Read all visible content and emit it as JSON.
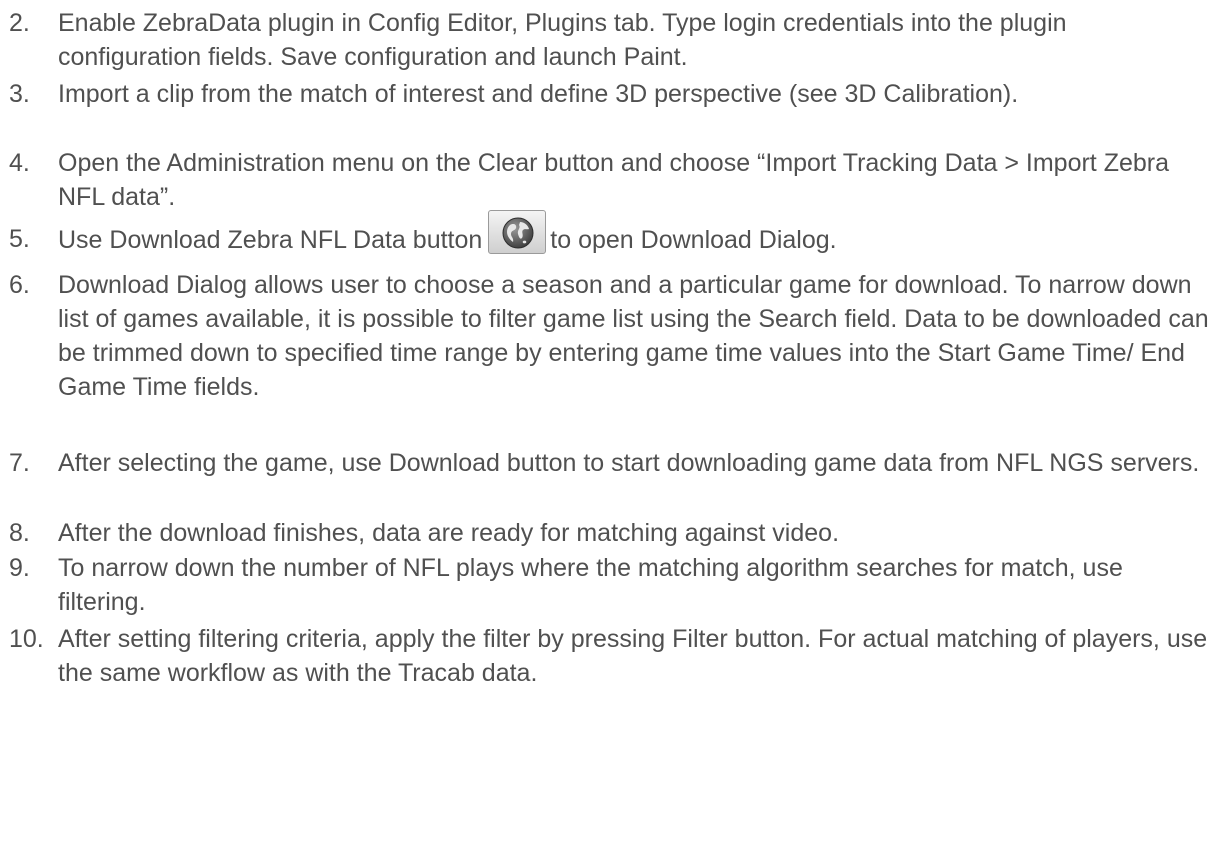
{
  "steps": [
    {
      "num": "2.",
      "text": "Enable ZebraData plugin in Config Editor, Plugins tab. Type login credentials into the plugin configuration fields. Save configuration and launch Paint."
    },
    {
      "num": "3.",
      "text": "Import a clip from the match of interest and define 3D perspective (see 3D Calibration)."
    },
    {
      "num": "4.",
      "text": "Open the Administration menu on the Clear button and choose “Import Tracking Data > Import Zebra NFL data”."
    },
    {
      "num": "5.",
      "text_before": "Use Download Zebra NFL Data  button",
      "icon": "globe-icon",
      "text_after": "to open Download Dialog."
    },
    {
      "num": "6.",
      "text": "Download Dialog allows user to choose a season and a particular game for download. To narrow down list of games available, it is possible to filter game list using the Search field. Data to be downloaded can be trimmed down to specified time range by entering game time values into the Start Game Time/ End Game Time fields."
    },
    {
      "num": "7.",
      "text": "After selecting the game, use Download button to start downloading game data from NFL NGS servers."
    },
    {
      "num": "8.",
      "text": "After the download finishes, data are ready for matching against video."
    },
    {
      "num": "9.",
      "text": "To narrow down the number of NFL plays where the matching algorithm searches for match, use filtering."
    },
    {
      "num": "10.",
      "text": "After setting filtering criteria, apply the filter by pressing Filter button. For actual matching of players, use the same workflow as with the Tracab data."
    }
  ],
  "colors": {
    "text": "#505050",
    "background": "#ffffff"
  }
}
